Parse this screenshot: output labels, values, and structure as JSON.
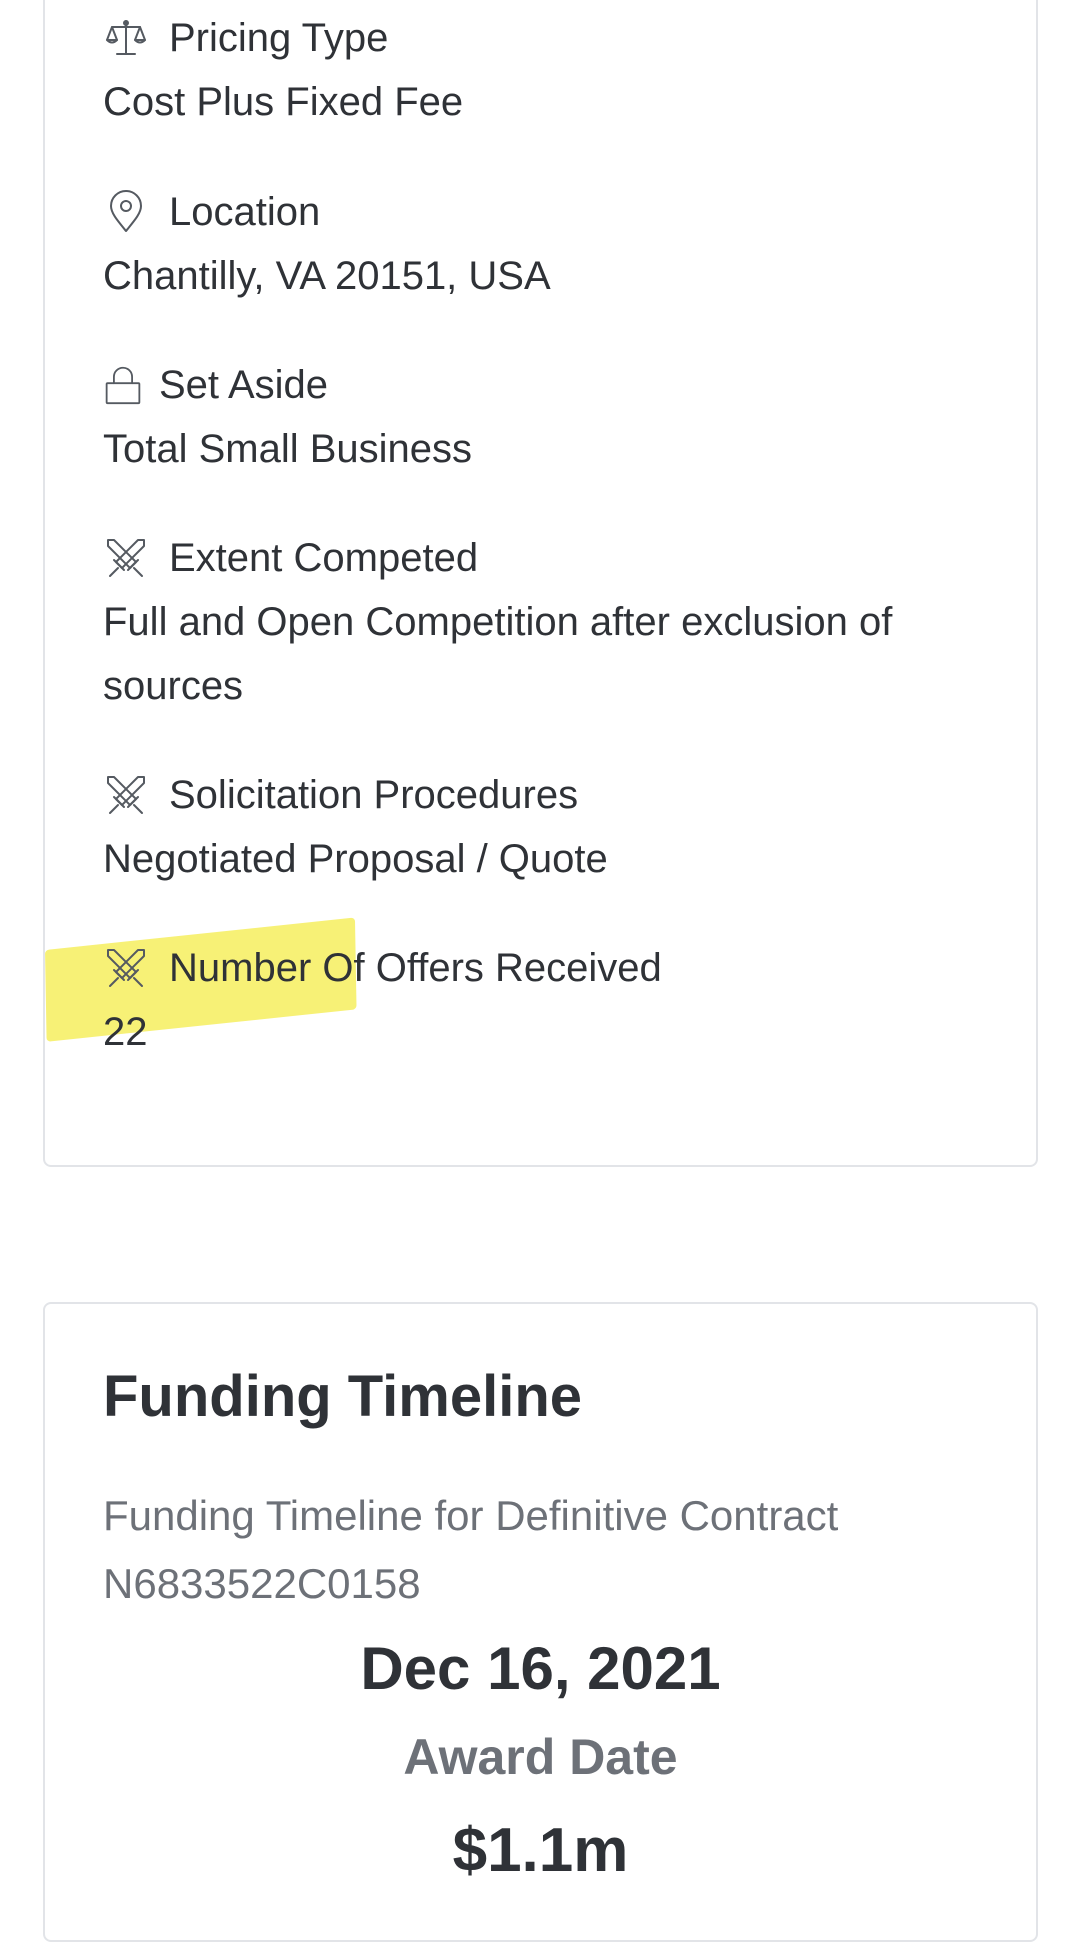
{
  "details": {
    "fields": [
      {
        "icon": "balance-scale-icon",
        "label": "Pricing Type",
        "value": "Cost Plus Fixed Fee"
      },
      {
        "icon": "map-pin-icon",
        "label": "Location",
        "value": "Chantilly, VA 20151, USA"
      },
      {
        "icon": "lock-icon",
        "label": "Set Aside",
        "value": "Total Small Business"
      },
      {
        "icon": "crossed-swords-icon",
        "label": "Extent Competed",
        "value": "Full and Open Competition after exclusion of sources"
      },
      {
        "icon": "crossed-swords-icon",
        "label": "Solicitation Procedures",
        "value": "Negotiated Proposal / Quote"
      },
      {
        "icon": "crossed-swords-icon",
        "label": "Number Of Offers Received",
        "value": "22"
      }
    ],
    "highlight_color": "#f6ef5e"
  },
  "funding": {
    "title": "Funding Timeline",
    "subtitle": "Funding Timeline for Definitive Contract N6833522C0158",
    "award_date": "Dec 16, 2021",
    "award_date_label": "Award Date",
    "amount": "$1.1m"
  },
  "colors": {
    "text": "#2f3237",
    "muted": "#6d7178",
    "border": "#e2e4e8"
  }
}
